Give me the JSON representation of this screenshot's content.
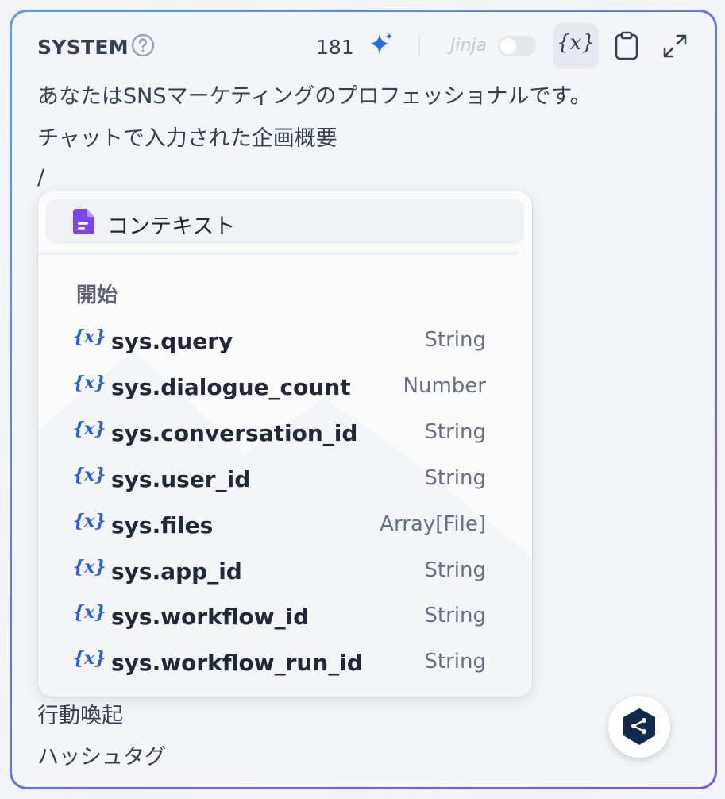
{
  "header": {
    "title": "SYSTEM",
    "token_count": "181",
    "jinja_label": "Jinja",
    "variable_button": "{x}"
  },
  "prompt_lines": [
    "あなたはSNSマーケティングのプロフェッショナルです。",
    "チャットで入力された企画概要",
    "/",
    "行動喚起",
    "ハッシュタグ"
  ],
  "popup": {
    "context_label": "コンテキスト",
    "group_title": "開始",
    "variables": [
      {
        "name": "sys.query",
        "type": "String"
      },
      {
        "name": "sys.dialogue_count",
        "type": "Number"
      },
      {
        "name": "sys.conversation_id",
        "type": "String"
      },
      {
        "name": "sys.user_id",
        "type": "String"
      },
      {
        "name": "sys.files",
        "type": "Array[File]"
      },
      {
        "name": "sys.app_id",
        "type": "String"
      },
      {
        "name": "sys.workflow_id",
        "type": "String"
      },
      {
        "name": "sys.workflow_run_id",
        "type": "String"
      }
    ]
  },
  "icons": {
    "help": "question-circle-icon",
    "sparkle": "sparkle-icon",
    "clipboard": "clipboard-icon",
    "expand": "expand-icon",
    "context": "document-icon",
    "variable": "variable-x-icon",
    "assistant": "dify-assistant-icon"
  },
  "colors": {
    "accent_blue": "#2b5fd9",
    "sparkle_blue": "#1d6ff2",
    "context_purple": "#7a46e8",
    "border_gradient_start": "#5b9df0",
    "border_gradient_end": "#7857e8"
  }
}
